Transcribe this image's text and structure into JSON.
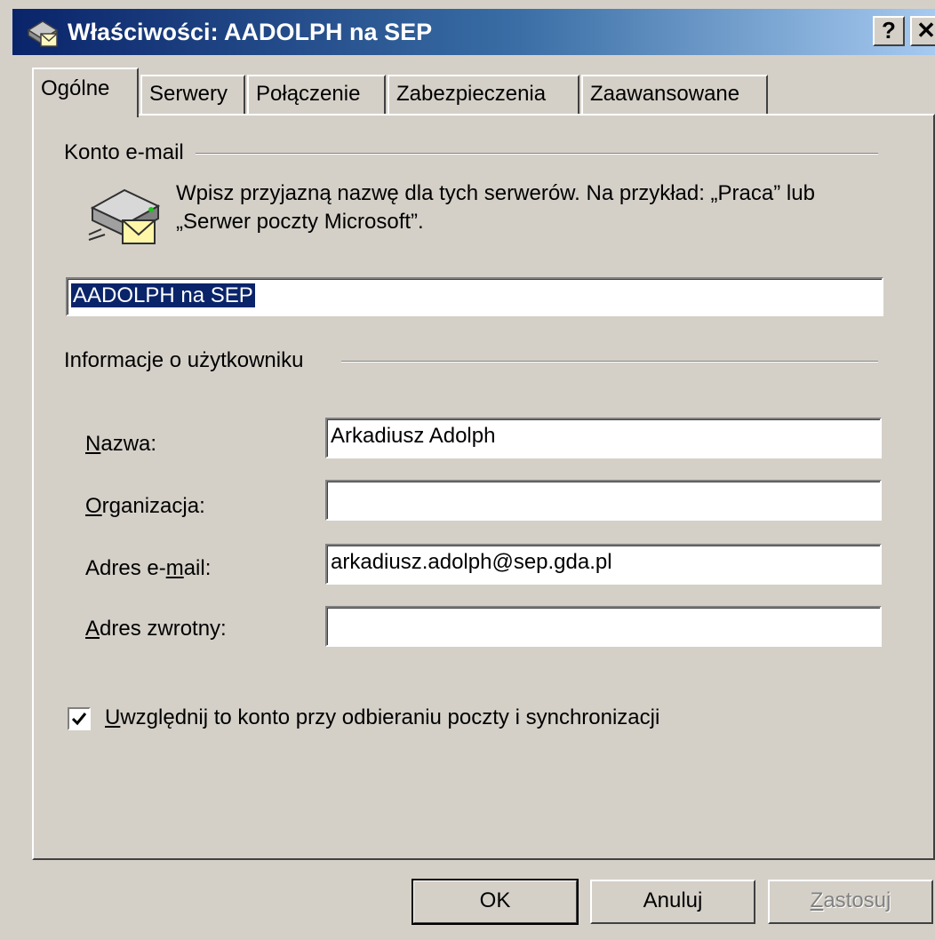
{
  "window": {
    "title": "Właściwości: AADOLPH na SEP",
    "help_label": "?",
    "close_label": "✕"
  },
  "tabs": [
    {
      "label": "Ogólne",
      "active": true
    },
    {
      "label": "Serwery",
      "active": false
    },
    {
      "label": "Połączenie",
      "active": false
    },
    {
      "label": "Zabezpieczenia",
      "active": false
    },
    {
      "label": "Zaawansowane",
      "active": false
    }
  ],
  "account": {
    "group_label": "Konto e-mail",
    "description_line1": "Wpisz przyjazną nazwę dla tych serwerów. Na przykład: „Praca” lub",
    "description_line2": "„Serwer poczty Microsoft”.",
    "name_value": "AADOLPH na SEP",
    "icon": "mail-server-icon"
  },
  "user_info": {
    "group_label": "Informacje o użytkowniku",
    "fields": [
      {
        "label_hotkey": "N",
        "label_rest": "azwa:",
        "value": "Arkadiusz Adolph"
      },
      {
        "label_hotkey": "O",
        "label_rest": "rganizacja:",
        "value": ""
      },
      {
        "label_pre": "Adres e-",
        "label_hotkey": "m",
        "label_rest": "ail:",
        "value": "arkadiusz.adolph@sep.gda.pl"
      },
      {
        "label_hotkey": "A",
        "label_rest": "dres zwrotny:",
        "value": ""
      }
    ]
  },
  "sync_checkbox": {
    "checked": true,
    "label_hotkey": "U",
    "label_rest": "względnij to konto przy odbieraniu poczty i synchronizacji"
  },
  "buttons": {
    "ok": "OK",
    "cancel": "Anuluj",
    "apply_hotkey": "Z",
    "apply_rest": "astosuj"
  }
}
